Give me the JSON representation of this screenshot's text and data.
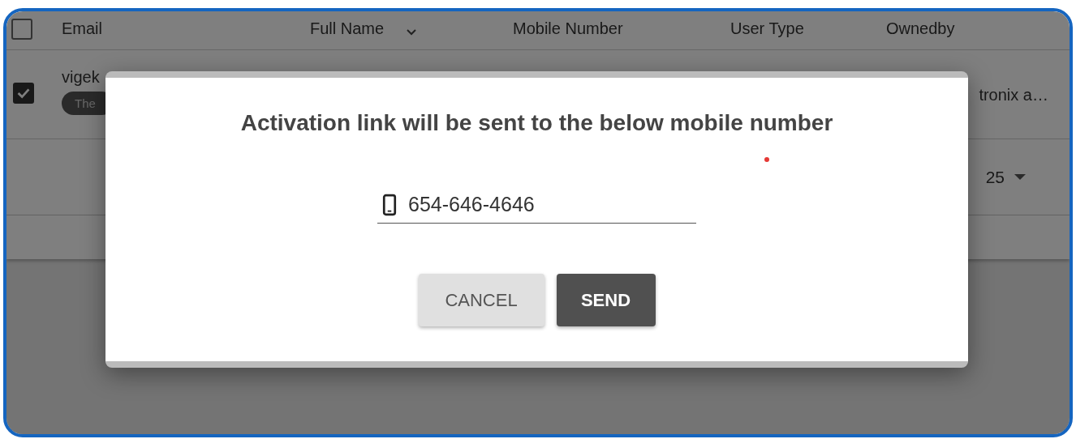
{
  "table": {
    "select_all": {
      "checked": false
    },
    "columns": [
      {
        "label": "Email",
        "sorted": false
      },
      {
        "label": "Full Name",
        "sorted": true
      },
      {
        "label": "Mobile Number",
        "sorted": false
      },
      {
        "label": "User Type",
        "sorted": false
      },
      {
        "label": "Ownedby",
        "sorted": false
      }
    ],
    "rows": [
      {
        "checked": true,
        "email": "vigek",
        "chip": "The",
        "owned_by": "tronix a…"
      }
    ]
  },
  "pagination": {
    "rows_per_page": "25"
  },
  "dialog": {
    "title": "Activation link will be sent to the below mobile number",
    "phone_field": {
      "value": "654-646-4646"
    },
    "buttons": [
      {
        "label": "CANCEL",
        "kind": "secondary"
      },
      {
        "label": "SEND",
        "kind": "primary"
      }
    ]
  }
}
